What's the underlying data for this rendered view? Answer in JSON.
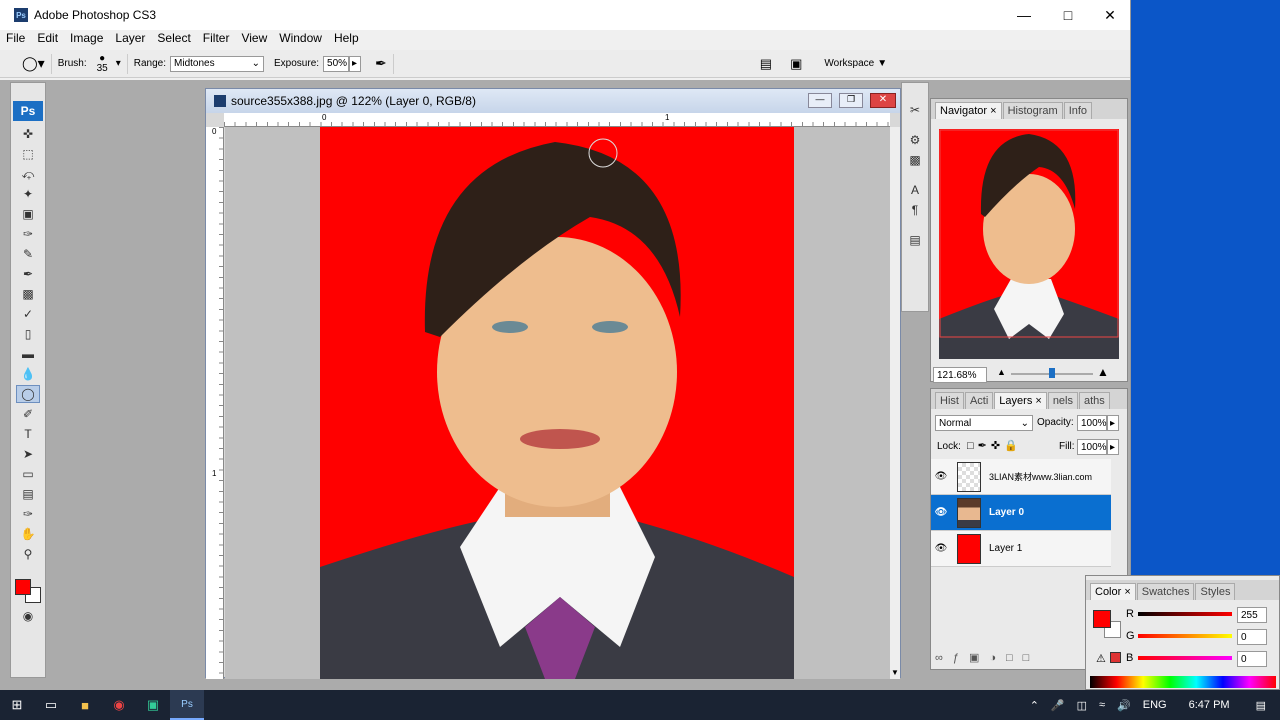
{
  "window": {
    "title": "Adobe Photoshop CS3",
    "app_icon": "Ps"
  },
  "menu": [
    "File",
    "Edit",
    "Image",
    "Layer",
    "Select",
    "Filter",
    "View",
    "Window",
    "Help"
  ],
  "options": {
    "brush_label": "Brush:",
    "brush_size": "35",
    "range_label": "Range:",
    "range_value": "Midtones",
    "exposure_label": "Exposure:",
    "exposure_value": "50%",
    "workspace_label": "Workspace"
  },
  "document": {
    "title": "source355x388.jpg @ 122% (Layer 0, RGB/8)",
    "ruler_h": [
      "0",
      "1"
    ],
    "ruler_v": [
      "0",
      "1"
    ]
  },
  "toolbox": {
    "logo": "Ps",
    "foreground_color": "#ff0000",
    "background_color": "#ffffff"
  },
  "navigator": {
    "tabs": [
      "Navigator",
      "Histogram",
      "Info"
    ],
    "zoom": "121.68%"
  },
  "layers": {
    "tabs": [
      "Hist",
      "Acti",
      "Layers",
      "nels",
      "aths"
    ],
    "blend_mode": "Normal",
    "opacity_label": "Opacity:",
    "opacity": "100%",
    "lock_label": "Lock:",
    "fill_label": "Fill:",
    "fill": "100%",
    "items": [
      {
        "name": "3LIAN素材www.3lian.com",
        "selected": false
      },
      {
        "name": "Layer 0",
        "selected": true
      },
      {
        "name": "Layer 1",
        "selected": false
      }
    ]
  },
  "color": {
    "tabs": [
      "Color",
      "Swatches",
      "Styles"
    ],
    "r_label": "R",
    "g_label": "G",
    "b_label": "B",
    "r": "255",
    "g": "0",
    "b": "0"
  },
  "taskbar": {
    "lang": "ENG",
    "time": "6:47 PM"
  },
  "colors": {
    "canvas_bg": "#ff0000",
    "selection": "#0a6fd0",
    "desktop": "#0b56c8"
  }
}
